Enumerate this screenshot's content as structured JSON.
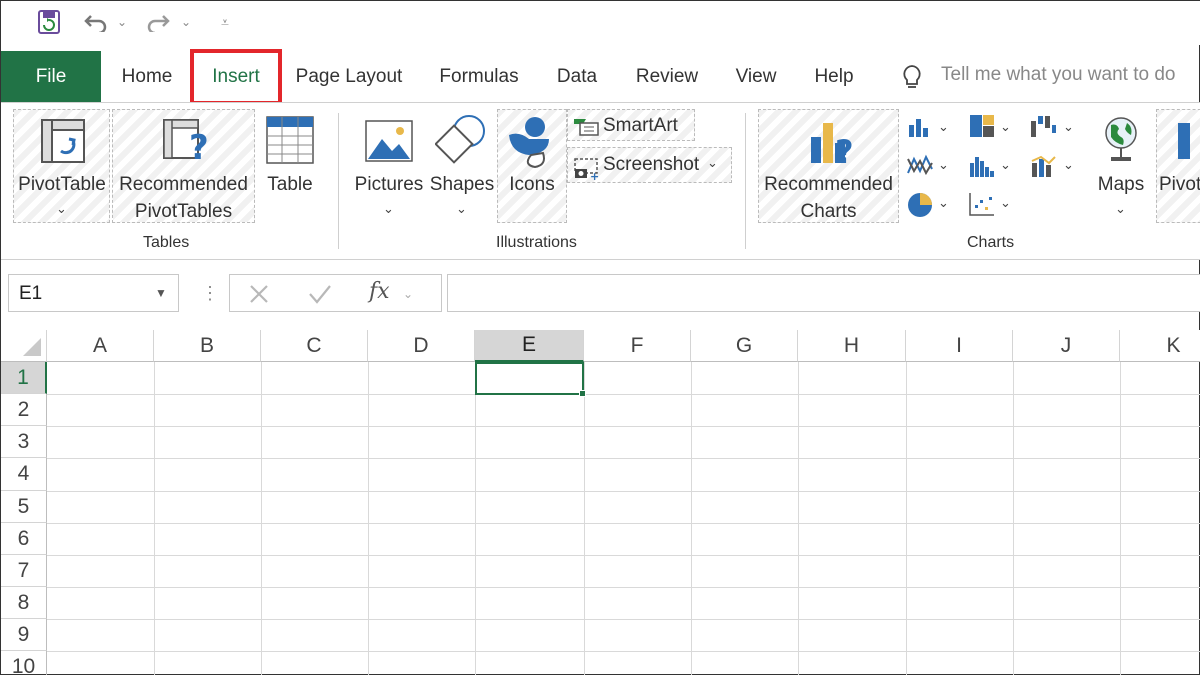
{
  "tabs": {
    "file": "File",
    "home": "Home",
    "insert": "Insert",
    "page_layout": "Page Layout",
    "formulas": "Formulas",
    "data": "Data",
    "review": "Review",
    "view": "View",
    "help": "Help"
  },
  "tell_me": "Tell me what you want to do",
  "ribbon": {
    "tables": {
      "label": "Tables",
      "pivot_table": "PivotTable",
      "recommended_pivot_1": "Recommended",
      "recommended_pivot_2": "PivotTables",
      "table": "Table"
    },
    "illustrations": {
      "label": "Illustrations",
      "pictures": "Pictures",
      "shapes": "Shapes",
      "icons": "Icons",
      "smartart": "SmartArt",
      "screenshot": "Screenshot"
    },
    "charts": {
      "label": "Charts",
      "recommended_1": "Recommended",
      "recommended_2": "Charts",
      "maps": "Maps",
      "pivot_partial": "Pivot"
    }
  },
  "name_box": "E1",
  "fx": "fx",
  "columns": [
    "A",
    "B",
    "C",
    "D",
    "E",
    "F",
    "G",
    "H",
    "I",
    "J",
    "K"
  ],
  "rows": [
    "1",
    "2",
    "3",
    "4",
    "5",
    "6",
    "7",
    "8",
    "9",
    "10"
  ],
  "colors": {
    "excel_green": "#217346",
    "highlight_red": "#e3262b"
  }
}
